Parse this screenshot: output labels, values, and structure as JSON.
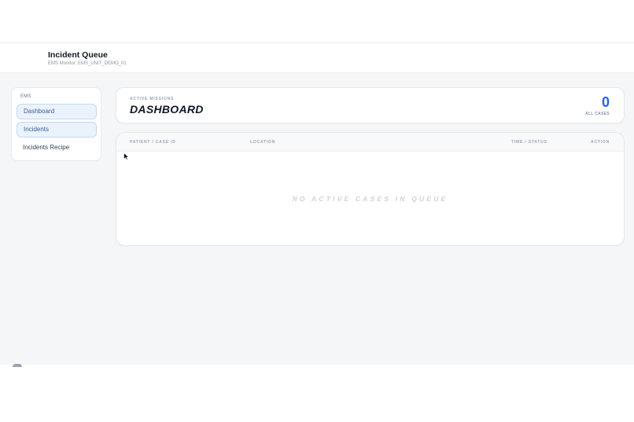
{
  "header": {
    "title": "Incident Queue",
    "subtitle": "EMS Monitor: EMS_UNIT_DEMO_01"
  },
  "sidebar": {
    "section_label": "EMS",
    "items": [
      {
        "label": "Dashboard",
        "active": true
      },
      {
        "label": "Incidents",
        "active": true
      },
      {
        "label": "Incidents Recipe",
        "active": false
      }
    ]
  },
  "hero": {
    "kicker": "ACTIVE MISSIONS",
    "title": "DASHBOARD",
    "count": "0",
    "count_label": "ALL CASES"
  },
  "table": {
    "columns": [
      "PATIENT / CASE ID",
      "LOCATION",
      "TIME / STATUS",
      "ACTION"
    ],
    "empty_message": "NO ACTIVE CASES IN QUEUE"
  },
  "colors": {
    "accent": "#2563eb",
    "active_nav_bg": "#eaf2fc",
    "active_nav_border": "#c5d9f2"
  },
  "icons": [
    "cursor-arrow-icon"
  ]
}
